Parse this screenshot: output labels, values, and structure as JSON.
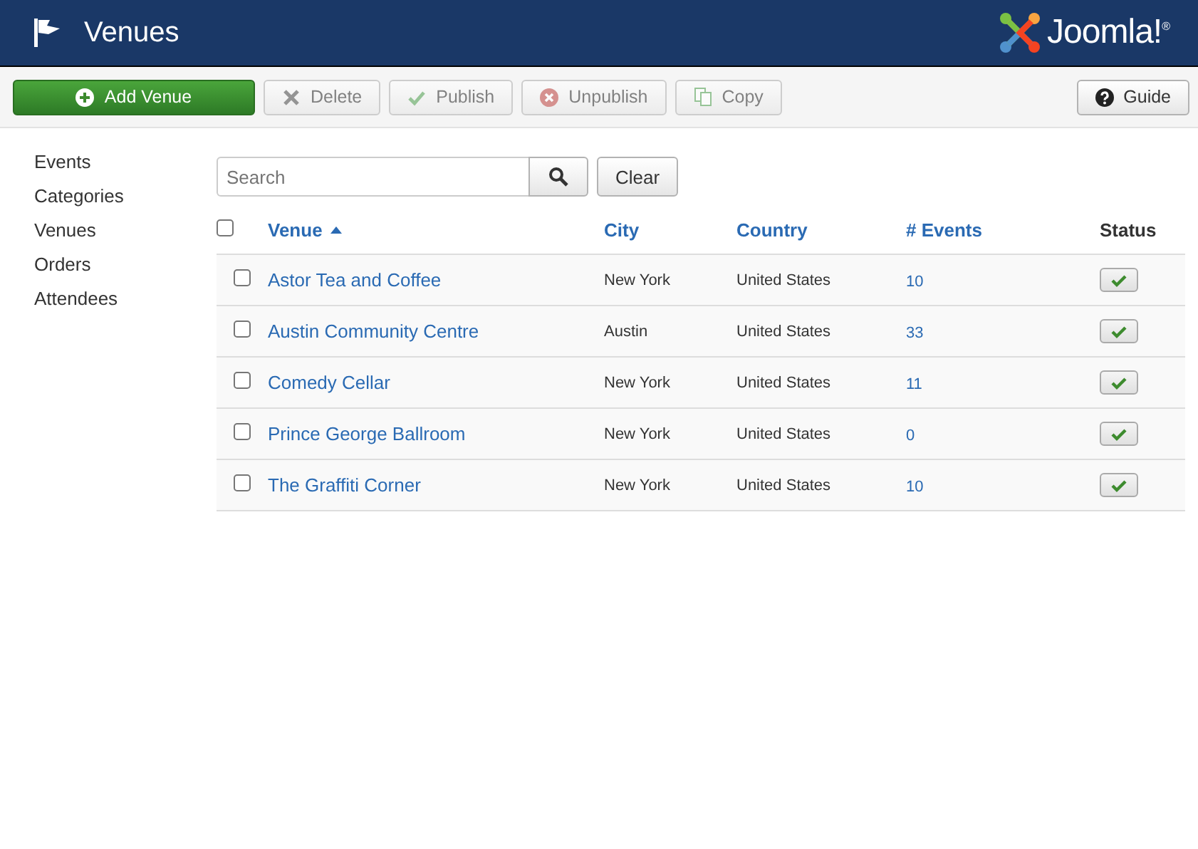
{
  "header": {
    "title": "Venues",
    "brand": "Joomla!$^{®}$"
  },
  "toolbar": [
    {
      "label": "Add Venue",
      "kind": "add",
      "disabled": false
    },
    {
      "label": "Delete",
      "kind": "delete",
      "disabled": true
    },
    {
      "label": "Publish",
      "kind": "publish",
      "disabled": true
    },
    {
      "label": "Unpublish",
      "kind": "unpublish",
      "disabled": true
    },
    {
      "label": "Copy",
      "kind": "copy",
      "disabled": true
    }
  ],
  "help_button": {
    "label": "Guide"
  },
  "sidebar": {
    "items": [
      {
        "label": "Events",
        "selected": false
      },
      {
        "label": "Categories",
        "selected": false
      },
      {
        "label": "Venues",
        "selected": false
      },
      {
        "label": "Orders",
        "selected": false
      },
      {
        "label": "Attendees",
        "selected": false
      }
    ]
  },
  "search": {
    "placeholder": "Search",
    "clear": "Clear"
  },
  "table": {
    "select_all": {
      "checked": false
    },
    "columns": [
      {
        "label": "Venue",
        "sortable": true,
        "sorted": true
      },
      {
        "label": "City",
        "sortable": true,
        "sorted": false
      },
      {
        "label": "Country",
        "sortable": true,
        "sorted": false
      },
      {
        "label": "# Events",
        "sortable": true,
        "sorted": false
      },
      {
        "label": "Status",
        "sortable": false,
        "sorted": false
      }
    ],
    "rows": [
      {
        "checked": false,
        "venue": "Astor Tea and Coffee",
        "city": "New York",
        "country": "United States",
        "events": "10",
        "published": true
      },
      {
        "checked": false,
        "venue": "Austin Community Centre",
        "city": "Austin",
        "country": "United States",
        "events": "33",
        "published": true
      },
      {
        "checked": false,
        "venue": "Comedy Cellar",
        "city": "New York",
        "country": "United States",
        "events": "11",
        "published": true
      },
      {
        "checked": false,
        "venue": "Prince George Ballroom",
        "city": "New York",
        "country": "United States",
        "events": "0",
        "published": true
      },
      {
        "checked": false,
        "venue": "The Graffiti Corner",
        "city": "New York",
        "country": "United States",
        "events": "10",
        "published": true
      }
    ]
  }
}
